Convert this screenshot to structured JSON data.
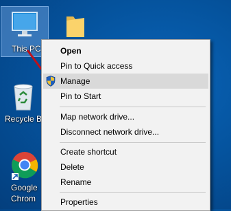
{
  "desktop": {
    "this_pc": "This PC",
    "recycle_bin": "Recycle Bin",
    "chrome_line1": "Google",
    "chrome_line2": "Chrom"
  },
  "context_menu": {
    "items": [
      {
        "label": "Open",
        "bold": true
      },
      {
        "label": "Pin to Quick access"
      },
      {
        "label": "Manage",
        "highlighted": true,
        "icon": "shield-icon"
      },
      {
        "label": "Pin to Start"
      },
      {
        "label": "Map network drive..."
      },
      {
        "label": "Disconnect network drive..."
      },
      {
        "label": "Create shortcut"
      },
      {
        "label": "Delete"
      },
      {
        "label": "Rename"
      },
      {
        "label": "Properties"
      }
    ]
  },
  "colors": {
    "desktop_bg": "#05549f",
    "menu_bg": "#f2f2f2",
    "highlight": "#d9d9d9",
    "arrow": "#c0111a"
  }
}
